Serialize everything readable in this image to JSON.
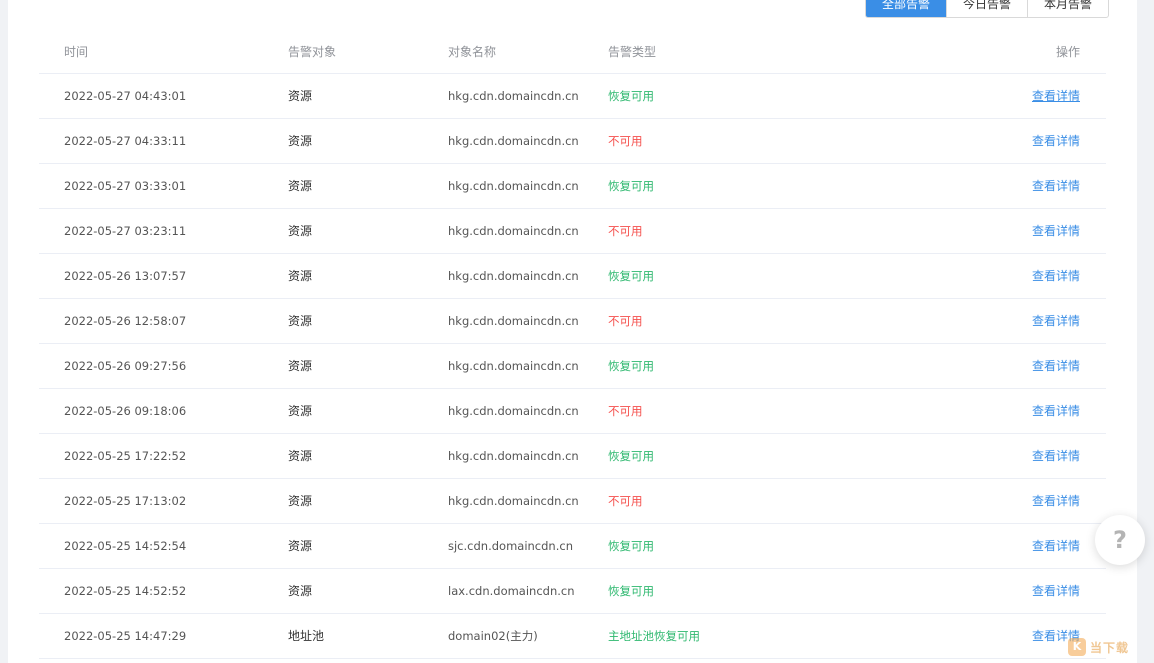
{
  "tabs": [
    {
      "label": "全部告警",
      "active": true
    },
    {
      "label": "今日告警",
      "active": false
    },
    {
      "label": "本月告警",
      "active": false
    }
  ],
  "columns": {
    "time": "时间",
    "target": "告警对象",
    "name": "对象名称",
    "type": "告警类型",
    "operation": "操作"
  },
  "rows": [
    {
      "time": "2022-05-27 04:43:01",
      "target": "资源",
      "name": "hkg.cdn.domaincdn.cn",
      "type": "恢复可用",
      "status": "ok",
      "action": "查看详情"
    },
    {
      "time": "2022-05-27 04:33:11",
      "target": "资源",
      "name": "hkg.cdn.domaincdn.cn",
      "type": "不可用",
      "status": "bad",
      "action": "查看详情"
    },
    {
      "time": "2022-05-27 03:33:01",
      "target": "资源",
      "name": "hkg.cdn.domaincdn.cn",
      "type": "恢复可用",
      "status": "ok",
      "action": "查看详情"
    },
    {
      "time": "2022-05-27 03:23:11",
      "target": "资源",
      "name": "hkg.cdn.domaincdn.cn",
      "type": "不可用",
      "status": "bad",
      "action": "查看详情"
    },
    {
      "time": "2022-05-26 13:07:57",
      "target": "资源",
      "name": "hkg.cdn.domaincdn.cn",
      "type": "恢复可用",
      "status": "ok",
      "action": "查看详情"
    },
    {
      "time": "2022-05-26 12:58:07",
      "target": "资源",
      "name": "hkg.cdn.domaincdn.cn",
      "type": "不可用",
      "status": "bad",
      "action": "查看详情"
    },
    {
      "time": "2022-05-26 09:27:56",
      "target": "资源",
      "name": "hkg.cdn.domaincdn.cn",
      "type": "恢复可用",
      "status": "ok",
      "action": "查看详情"
    },
    {
      "time": "2022-05-26 09:18:06",
      "target": "资源",
      "name": "hkg.cdn.domaincdn.cn",
      "type": "不可用",
      "status": "bad",
      "action": "查看详情"
    },
    {
      "time": "2022-05-25 17:22:52",
      "target": "资源",
      "name": "hkg.cdn.domaincdn.cn",
      "type": "恢复可用",
      "status": "ok",
      "action": "查看详情"
    },
    {
      "time": "2022-05-25 17:13:02",
      "target": "资源",
      "name": "hkg.cdn.domaincdn.cn",
      "type": "不可用",
      "status": "bad",
      "action": "查看详情"
    },
    {
      "time": "2022-05-25 14:52:54",
      "target": "资源",
      "name": "sjc.cdn.domaincdn.cn",
      "type": "恢复可用",
      "status": "ok",
      "action": "查看详情"
    },
    {
      "time": "2022-05-25 14:52:52",
      "target": "资源",
      "name": "lax.cdn.domaincdn.cn",
      "type": "恢复可用",
      "status": "ok",
      "action": "查看详情"
    },
    {
      "time": "2022-05-25 14:47:29",
      "target": "地址池",
      "name": "domain02(主力)",
      "type": "主地址池恢复可用",
      "status": "ok",
      "action": "查看详情"
    }
  ],
  "help": {
    "icon": "question-icon",
    "glyph": "?"
  },
  "watermark": {
    "logo": "K",
    "text": "当下载"
  },
  "colors": {
    "accent": "#3a8ee6",
    "ok": "#2eb86f",
    "bad": "#f5504d"
  }
}
